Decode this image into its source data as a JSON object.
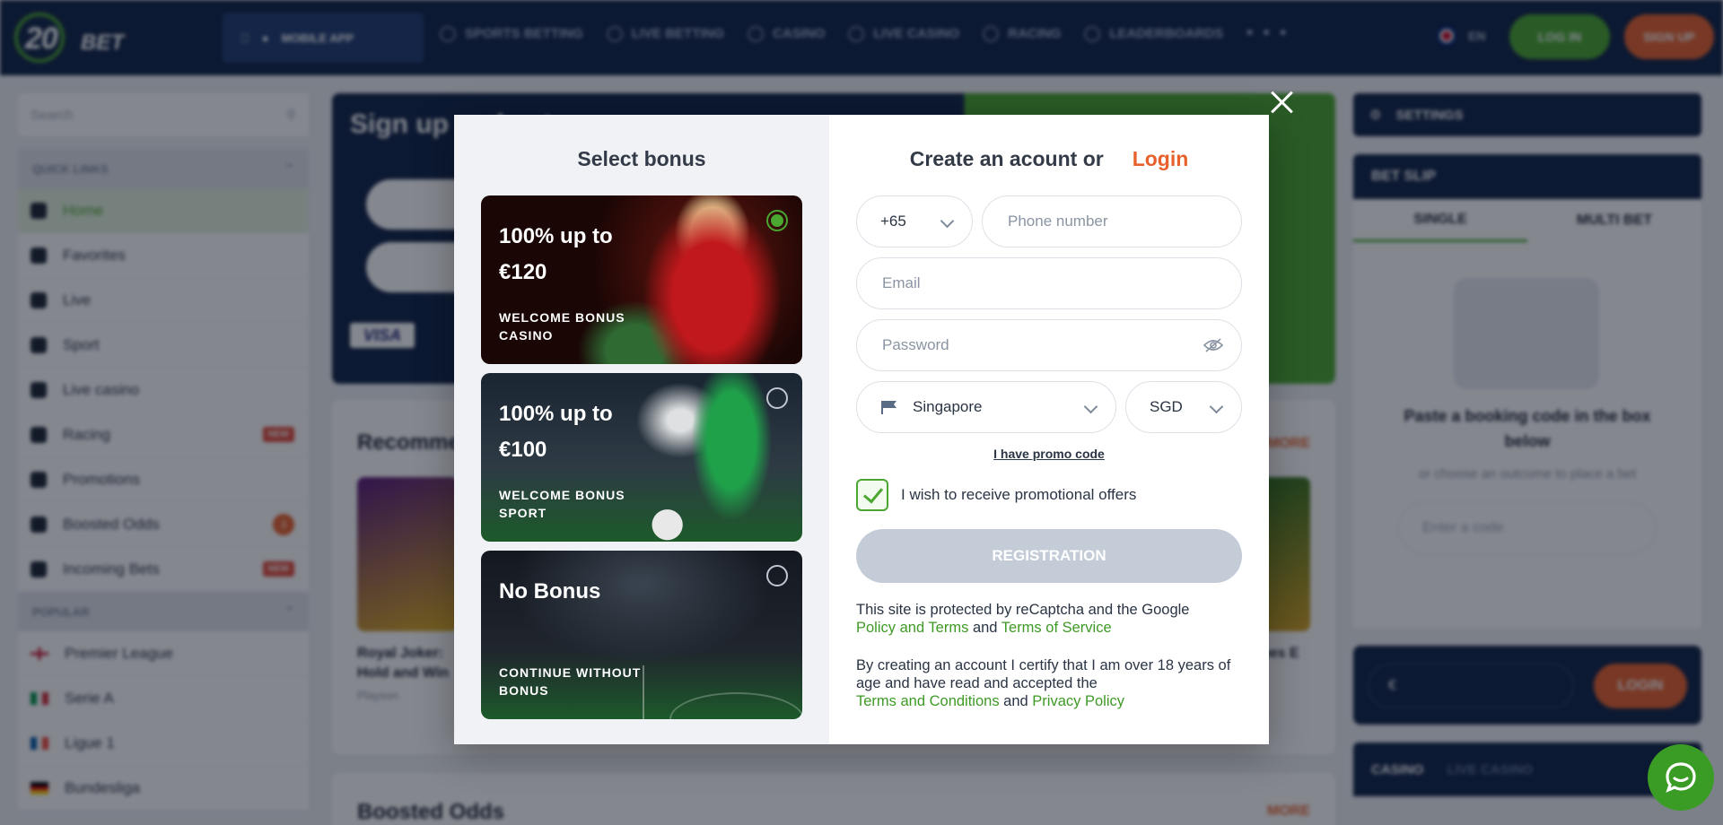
{
  "header": {
    "logo_text": "20",
    "logo_text2": "BET",
    "mobile_app": "MOBILE APP",
    "nav": [
      "SPORTS BETTING",
      "LIVE BETTING",
      "CASINO",
      "LIVE CASINO",
      "RACING",
      "LEADERBOARDS"
    ],
    "more": "• • •",
    "lang": "EN",
    "login": "LOG IN",
    "signup": "SIGN UP"
  },
  "sidebar": {
    "search_placeholder": "Search",
    "quick_links": "QUICK LINKS",
    "items": [
      {
        "label": "Home",
        "icon": "home-icon"
      },
      {
        "label": "Favorites",
        "icon": "star-icon"
      },
      {
        "label": "Live",
        "icon": "live-icon"
      },
      {
        "label": "Sport",
        "icon": "sport-icon"
      },
      {
        "label": "Live casino",
        "icon": "live-casino-icon"
      },
      {
        "label": "Racing",
        "icon": "racing-icon",
        "badge": "NEW"
      },
      {
        "label": "Promotions",
        "icon": "gift-icon"
      },
      {
        "label": "Boosted Odds",
        "icon": "boost-icon",
        "count": "3"
      },
      {
        "label": "Incoming Bets",
        "icon": "bets-icon",
        "badge": "NEW"
      }
    ],
    "popular": "POPULAR",
    "leagues": [
      "Premier League",
      "Serie A",
      "Ligue 1",
      "Bundesliga"
    ]
  },
  "banner": {
    "title": "Sign up and get",
    "payment": "VISA"
  },
  "recommended": {
    "title": "Recommended",
    "more": "MORE",
    "game1_title": "Royal Joker: Hold and Win",
    "game1_provider": "Playson",
    "game2_title": "Riches E Win"
  },
  "boosted": {
    "title": "Boosted Odds",
    "more": "MORE"
  },
  "right": {
    "settings": "SETTINGS",
    "bet_slip": "BET SLIP",
    "tabs": [
      "SINGLE",
      "MULTI BET"
    ],
    "paste": "Paste a booking code in the box below",
    "choose": "or choose an outcome to place a bet",
    "code_placeholder": "Enter a code",
    "currency_symbol": "€",
    "login": "LOGIN",
    "casino_tabs": [
      "CASINO",
      "LIVE CASINO"
    ]
  },
  "modal": {
    "select_bonus": "Select bonus",
    "bonuses": [
      {
        "amount": "100% up to €120",
        "label": "WELCOME BONUS CASINO",
        "selected": true
      },
      {
        "amount": "100% up to €100",
        "label": "WELCOME BONUS SPORT",
        "selected": false
      },
      {
        "amount": "No Bonus",
        "label": "CONTINUE WITHOUT BONUS",
        "selected": false
      }
    ],
    "create_account": "Create an acount or",
    "login_link": "Login",
    "phone_code": "+65",
    "phone_placeholder": "Phone number",
    "email_placeholder": "Email",
    "password_placeholder": "Password",
    "country": "Singapore",
    "currency": "SGD",
    "promo_code": "I have promo code",
    "promo_offers": "I wish to receive promotional offers",
    "promo_offers_checked": true,
    "registration": "REGISTRATION",
    "legal1_text": "This site is protected by reCaptcha and the Google",
    "legal1_link1": "Policy and Terms",
    "legal1_and": "and",
    "legal1_link2": "Terms of Service",
    "legal2_text": "By creating an account I certify that I am over 18 years of age and have read and accepted the",
    "legal2_link1": "Terms and Conditions",
    "legal2_and": "and",
    "legal2_link2": "Privacy Policy"
  },
  "colors": {
    "brand_green": "#4aa72f",
    "brand_orange": "#e8612c",
    "navy": "#0f2246"
  }
}
